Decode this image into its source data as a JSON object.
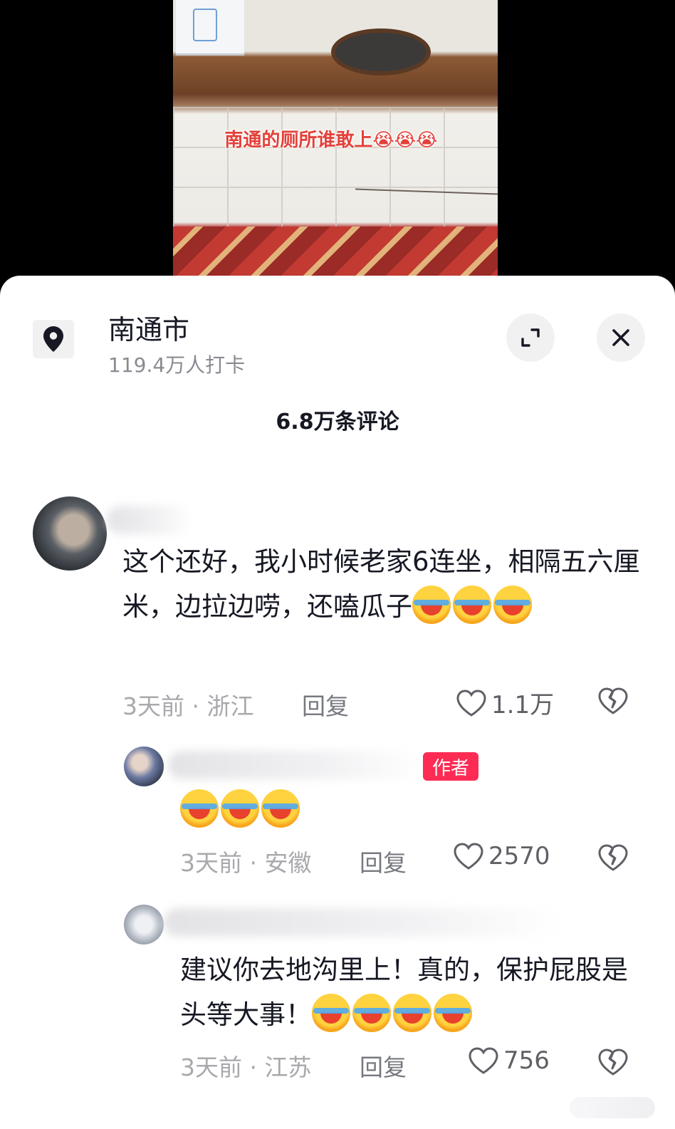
{
  "video": {
    "caption": "南通的厕所谁敢上😭😭😭"
  },
  "location": {
    "icon": "location-pin-icon",
    "name": "南通市",
    "checkins": "119.4万人打卡"
  },
  "header_buttons": {
    "expand_icon": "expand-icon",
    "close_icon": "close-icon"
  },
  "comments_count": "6.8万条评论",
  "comments": [
    {
      "text": "这个还好，我小时候老家6连坐，相隔五六厘米，边拉边唠，还嗑瓜子",
      "emoji_count": 3,
      "emoji_icon": "laugh-cry-emoji-icon",
      "time_region": "3天前 · 浙江",
      "reply_label": "回复",
      "likes": "1.1万"
    },
    {
      "badge": "作者",
      "text": "",
      "emoji_count": 3,
      "emoji_icon": "laugh-cry-emoji-icon",
      "time_region": "3天前 · 安徽",
      "reply_label": "回复",
      "likes": "2570"
    },
    {
      "text": "建议你去地沟里上！真的，保护屁股是头等大事！",
      "emoji_count": 4,
      "emoji_icon": "laugh-cry-emoji-icon",
      "time_region": "3天前 · 江苏",
      "reply_label": "回复",
      "likes": "756"
    }
  ],
  "colors": {
    "accent": "#fe2c55",
    "text_primary": "#161823",
    "text_secondary": "#a8a9ad",
    "caption_red": "#e4403a"
  }
}
